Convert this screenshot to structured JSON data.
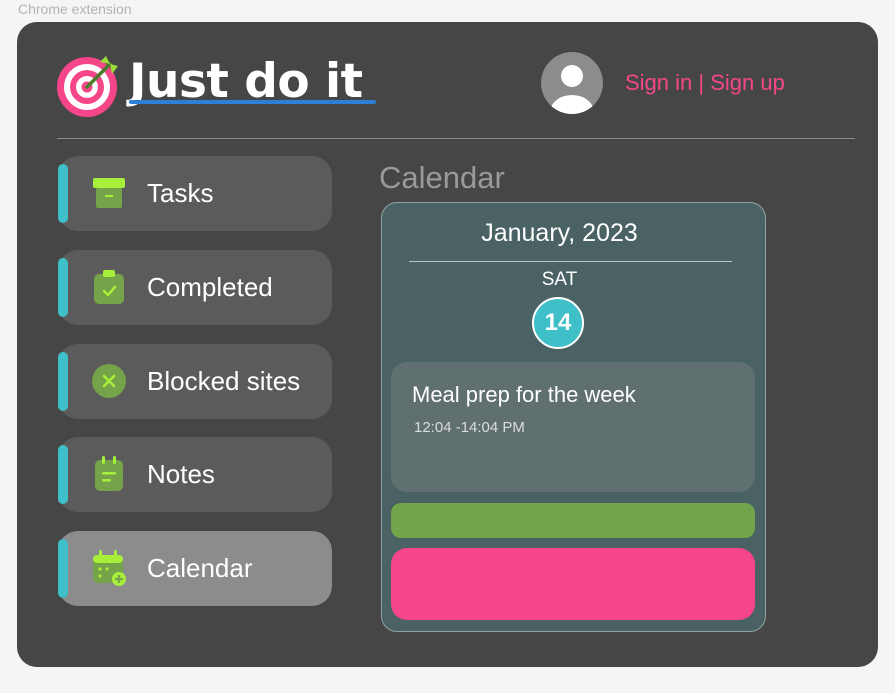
{
  "frame_label": "Chrome extension",
  "header": {
    "title": "Just do it",
    "auth": {
      "sign_in": "Sign in",
      "separator": " | ",
      "sign_up": "Sign up"
    }
  },
  "sidebar": {
    "items": [
      {
        "label": "Tasks",
        "icon": "archive-box-icon",
        "active": false
      },
      {
        "label": "Completed",
        "icon": "clipboard-check-icon",
        "active": false
      },
      {
        "label": "Blocked sites",
        "icon": "circle-x-icon",
        "active": false
      },
      {
        "label": "Notes",
        "icon": "notepad-icon",
        "active": false
      },
      {
        "label": "Calendar",
        "icon": "calendar-add-icon",
        "active": true
      }
    ]
  },
  "main": {
    "section_title": "Calendar",
    "calendar": {
      "month": "January, 2023",
      "weekday": "SAT",
      "day": "14",
      "events": [
        {
          "title": "Meal prep for the week",
          "time": "12:04 -14:04 PM"
        }
      ]
    }
  },
  "colors": {
    "accent_teal": "#3fbfc8",
    "accent_pink": "#f5468a",
    "accent_green": "#72a44b",
    "panel_bg": "#464646",
    "title_underline": "#2e7fd6"
  }
}
